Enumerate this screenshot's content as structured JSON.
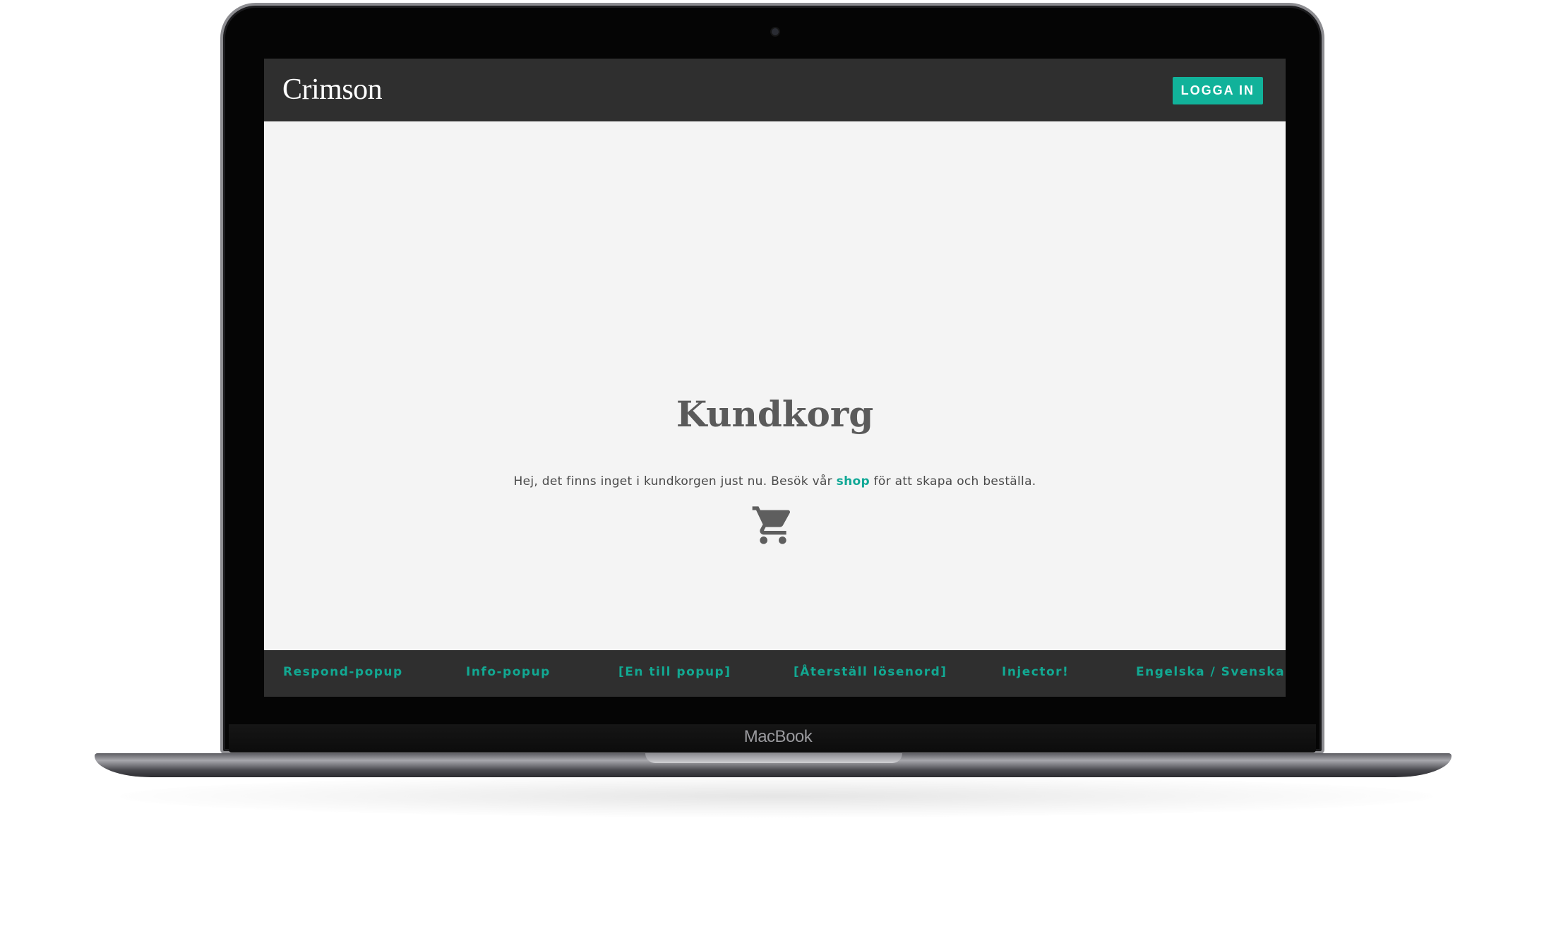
{
  "device": {
    "label": "MacBook"
  },
  "header": {
    "logo": "Crimson",
    "login_label": "LOGGA IN"
  },
  "main": {
    "title": "Kundkorg",
    "message_before": "Hej, det finns inget i kundkorgen just nu. Besök vår ",
    "message_link": "shop",
    "message_after": " för att skapa och beställa.",
    "icon": "shopping-cart-icon"
  },
  "footer": {
    "links": [
      "Respond-popup",
      "Info-popup",
      "[En till popup]",
      "[Återställ lösenord]",
      "Injector!",
      "Engelska / Svenska"
    ]
  },
  "colors": {
    "accent": "#11b29a",
    "header_bg": "#2f2f2f",
    "page_bg": "#f4f4f4",
    "text": "#5a5a5a"
  }
}
